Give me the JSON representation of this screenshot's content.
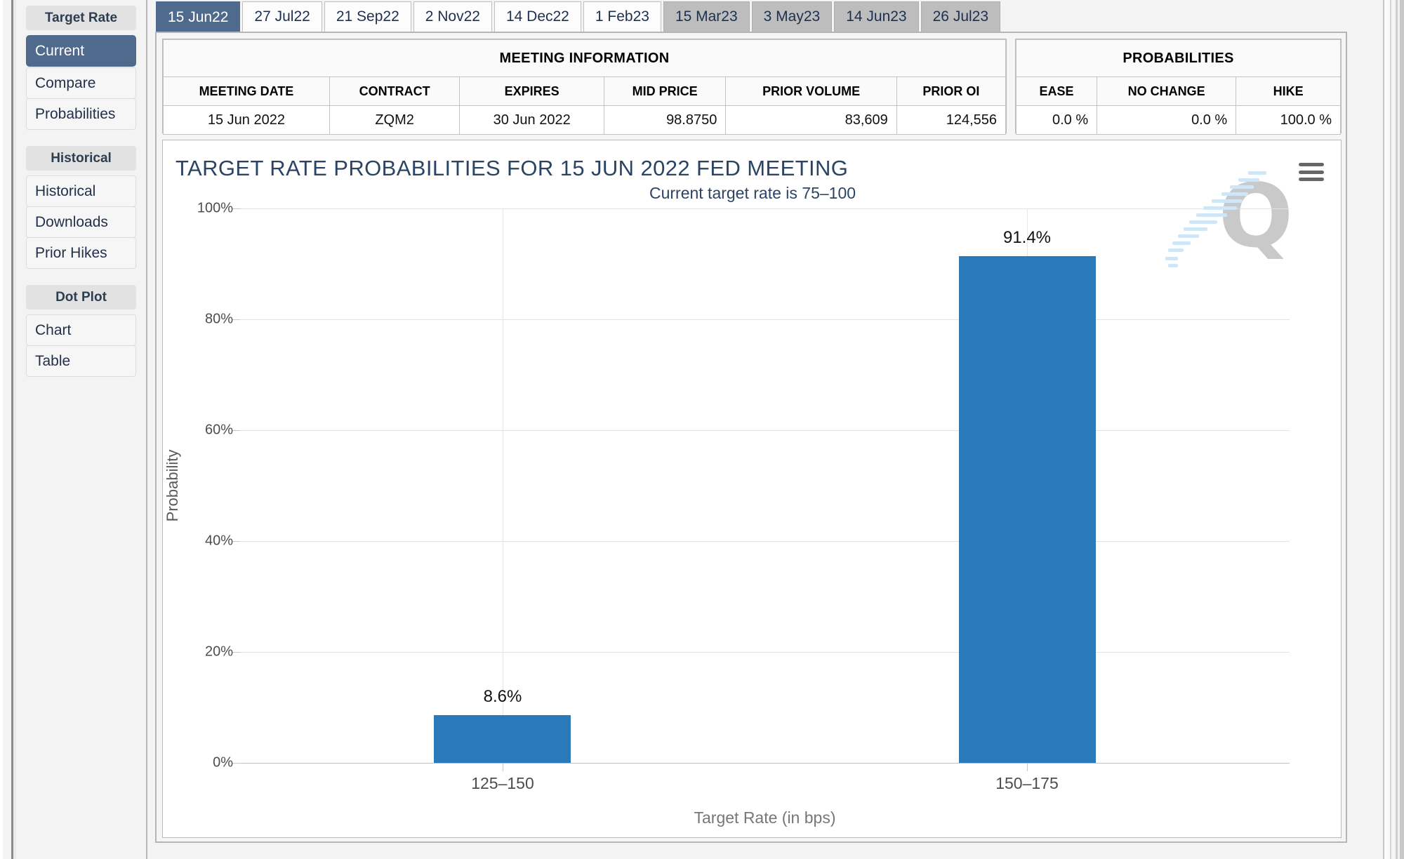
{
  "sidebar": {
    "sections": [
      {
        "header": "Target Rate",
        "items": [
          {
            "label": "Current",
            "active": true
          },
          {
            "label": "Compare",
            "active": false
          },
          {
            "label": "Probabilities",
            "active": false
          }
        ]
      },
      {
        "header": "Historical",
        "items": [
          {
            "label": "Historical",
            "active": false
          },
          {
            "label": "Downloads",
            "active": false
          },
          {
            "label": "Prior Hikes",
            "active": false
          }
        ]
      },
      {
        "header": "Dot Plot",
        "items": [
          {
            "label": "Chart",
            "active": false
          },
          {
            "label": "Table",
            "active": false
          }
        ]
      }
    ]
  },
  "tabs": [
    {
      "label": "15 Jun22",
      "state": "active"
    },
    {
      "label": "27 Jul22",
      "state": "normal"
    },
    {
      "label": "21 Sep22",
      "state": "normal"
    },
    {
      "label": "2 Nov22",
      "state": "normal"
    },
    {
      "label": "14 Dec22",
      "state": "normal"
    },
    {
      "label": "1 Feb23",
      "state": "normal"
    },
    {
      "label": "15 Mar23",
      "state": "disabled"
    },
    {
      "label": "3 May23",
      "state": "disabled"
    },
    {
      "label": "14 Jun23",
      "state": "disabled"
    },
    {
      "label": "26 Jul23",
      "state": "disabled"
    }
  ],
  "meeting_information": {
    "group_header": "MEETING INFORMATION",
    "columns": [
      "MEETING DATE",
      "CONTRACT",
      "EXPIRES",
      "MID PRICE",
      "PRIOR VOLUME",
      "PRIOR OI"
    ],
    "row": {
      "meeting_date": "15 Jun 2022",
      "contract": "ZQM2",
      "expires": "30 Jun 2022",
      "mid_price": "98.8750",
      "prior_volume": "83,609",
      "prior_oi": "124,556"
    }
  },
  "probabilities_table": {
    "group_header": "PROBABILITIES",
    "columns": [
      "EASE",
      "NO CHANGE",
      "HIKE"
    ],
    "row": {
      "ease": "0.0 %",
      "no_change": "0.0 %",
      "hike": "100.0 %"
    }
  },
  "chart_panel": {
    "menu_icon": "hamburger-menu-icon",
    "watermark_letter": "Q"
  },
  "colors": {
    "bar": "#2a7ab9",
    "accent_navy": "#2b4465",
    "active_tab": "#4f6a8c",
    "disabled_tab": "#bdbdbd"
  },
  "chart_data": {
    "type": "bar",
    "title": "TARGET RATE PROBABILITIES FOR 15 JUN 2022 FED MEETING",
    "subtitle": "Current target rate is 75–100",
    "xlabel": "Target Rate (in bps)",
    "ylabel": "Probability",
    "categories": [
      "125–150",
      "150–175"
    ],
    "values": [
      8.6,
      91.4
    ],
    "value_labels": [
      "8.6%",
      "91.4%"
    ],
    "ylim": [
      0,
      100
    ],
    "yticks": [
      0,
      20,
      40,
      60,
      80,
      100
    ],
    "ytick_labels": [
      "0%",
      "20%",
      "40%",
      "60%",
      "80%",
      "100%"
    ],
    "grid": true,
    "legend": "none"
  }
}
